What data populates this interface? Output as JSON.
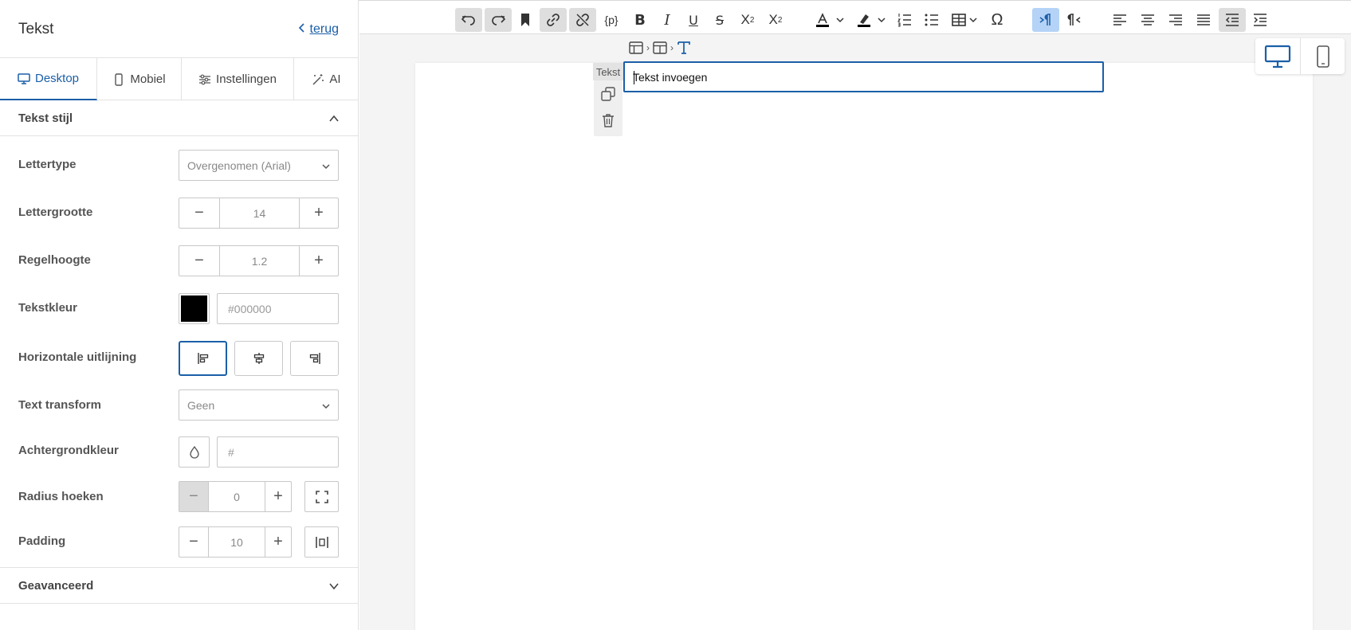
{
  "sidebar": {
    "title": "Tekst",
    "back_label": "terug",
    "tabs": [
      {
        "label": "Desktop",
        "icon": "monitor-icon"
      },
      {
        "label": "Mobiel",
        "icon": "phone-icon"
      },
      {
        "label": "Instellingen",
        "icon": "sliders-icon"
      },
      {
        "label": "AI",
        "icon": "magic-wand-icon"
      }
    ],
    "section_text_style": "Tekst stijl",
    "section_advanced": "Geavanceerd",
    "font": {
      "label": "Lettertype",
      "value": "Overgenomen (Arial)"
    },
    "font_size": {
      "label": "Lettergrootte",
      "value": "14"
    },
    "line_height": {
      "label": "Regelhoogte",
      "value": "1.2"
    },
    "text_color": {
      "label": "Tekstkleur",
      "value": "#000000",
      "swatch": "#000000"
    },
    "h_align": {
      "label": "Horizontale uitlijning",
      "selected": "left"
    },
    "text_transform": {
      "label": "Text transform",
      "value": "Geen"
    },
    "bg_color": {
      "label": "Achtergrondkleur",
      "value": "#"
    },
    "radius": {
      "label": "Radius hoeken",
      "value": "0"
    },
    "padding": {
      "label": "Padding",
      "value": "10"
    }
  },
  "editor": {
    "block_tag": "Tekst",
    "text_block_value": "Tekst invoegen",
    "placeholder_token": "{p}",
    "special_char": "Ω",
    "accent_color": "#1b5fa8"
  }
}
